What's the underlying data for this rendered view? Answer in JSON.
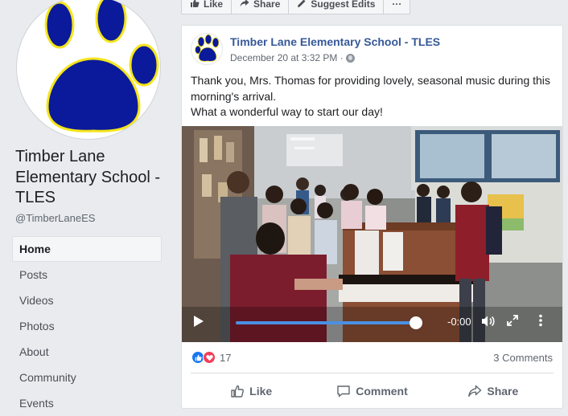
{
  "sidebar": {
    "page_name": "Timber Lane Elementary School - TLES",
    "handle": "@TimberLaneES",
    "nav": [
      "Home",
      "Posts",
      "Videos",
      "Photos",
      "About",
      "Community",
      "Events"
    ],
    "active": "Home"
  },
  "action_bar": {
    "like_label": "Like",
    "share_label": "Share",
    "suggest_label": "Suggest Edits",
    "more_label": "···"
  },
  "post": {
    "author": "Timber Lane Elementary School - TLES",
    "timestamp": "December 20 at 3:32 PM ·",
    "text_line1": "Thank you, Mrs. Thomas for providing lovely, seasonal music during this morning's arrival.",
    "text_line2": "What a wonderful way to start our day!",
    "video": {
      "time_remaining": "-0:00",
      "progress": 1.0
    },
    "reaction_count": "17",
    "comments": "3 Comments",
    "actions": {
      "like": "Like",
      "comment": "Comment",
      "share": "Share"
    }
  },
  "colors": {
    "brand_blue": "#365899",
    "paw_blue": "#0a1a9a",
    "paw_outline": "#f5e51b",
    "scrub_blue": "#4a90e2",
    "love_red": "#f33e58"
  },
  "icons": {
    "action_like": "thumbs-up-icon",
    "action_share": "share-icon",
    "action_suggest": "pencil-icon",
    "privacy": "globe-icon",
    "video_play": "play-icon",
    "video_volume": "volume-icon",
    "video_expand": "expand-icon",
    "video_more": "more-vertical-icon"
  }
}
